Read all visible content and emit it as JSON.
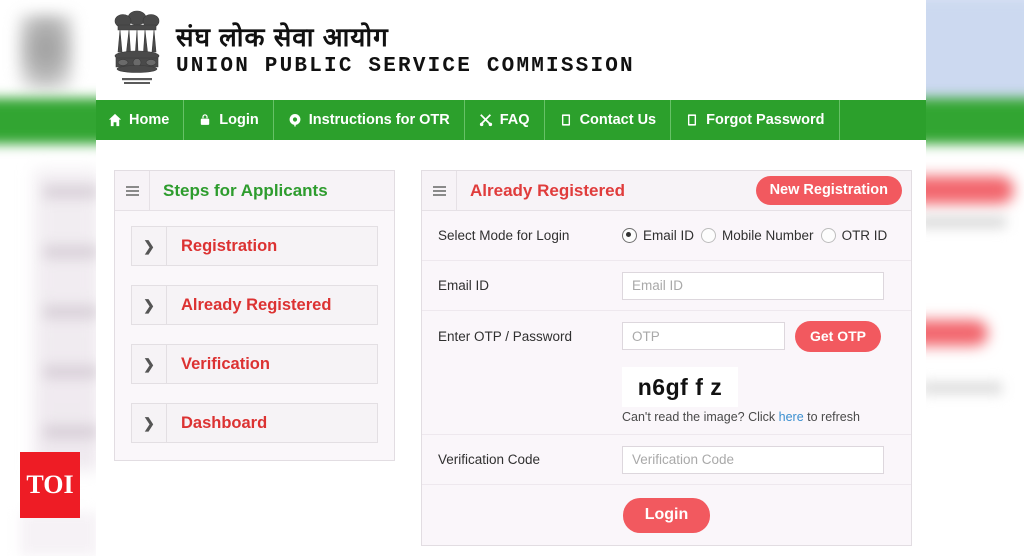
{
  "background": {
    "watermark": "TOI"
  },
  "header": {
    "emblem_icon": "ashoka-emblem-icon",
    "title_hindi": "संघ लोक सेवा आयोग",
    "title_english": "UNION PUBLIC SERVICE COMMISSION"
  },
  "nav": {
    "items": [
      {
        "label": "Home",
        "icon": "home-icon"
      },
      {
        "label": "Login",
        "icon": "lock-icon"
      },
      {
        "label": "Instructions for OTR",
        "icon": "info-circle-icon"
      },
      {
        "label": "FAQ",
        "icon": "scissors-icon"
      },
      {
        "label": "Contact Us",
        "icon": "document-icon"
      },
      {
        "label": "Forgot Password",
        "icon": "document-icon"
      }
    ]
  },
  "left_panel": {
    "menu_icon": "hamburger-icon",
    "title": "Steps for Applicants",
    "steps": [
      {
        "label": "Registration",
        "chevron": "chevron-right-icon"
      },
      {
        "label": "Already Registered",
        "chevron": "chevron-right-icon"
      },
      {
        "label": "Verification",
        "chevron": "chevron-right-icon"
      },
      {
        "label": "Dashboard",
        "chevron": "chevron-right-icon"
      }
    ]
  },
  "login_panel": {
    "menu_icon": "hamburger-icon",
    "title": "Already Registered",
    "new_registration_label": "New Registration",
    "mode_label": "Select Mode for Login",
    "modes": [
      {
        "label": "Email ID",
        "selected": true
      },
      {
        "label": "Mobile Number",
        "selected": false
      },
      {
        "label": "OTR ID",
        "selected": false
      }
    ],
    "email_label": "Email ID",
    "email_placeholder": "Email ID",
    "email_value": "",
    "otp_label": "Enter OTP / Password",
    "otp_placeholder": "OTP",
    "otp_value": "",
    "get_otp_label": "Get OTP",
    "captcha_text": "n6gf f z",
    "captcha_hint_before": "Can't read the image? Click ",
    "captcha_hint_link": "here",
    "captcha_hint_after": " to refresh",
    "verification_label": "Verification Code",
    "verification_placeholder": "Verification Code",
    "verification_value": "",
    "login_label": "Login"
  },
  "colors": {
    "nav_green": "#2ca02c",
    "title_green": "#2e9c2e",
    "accent_red": "#dc3232",
    "button_red": "#f2595f",
    "link_blue": "#3a8fd0",
    "toi_red": "#ee1c25"
  }
}
